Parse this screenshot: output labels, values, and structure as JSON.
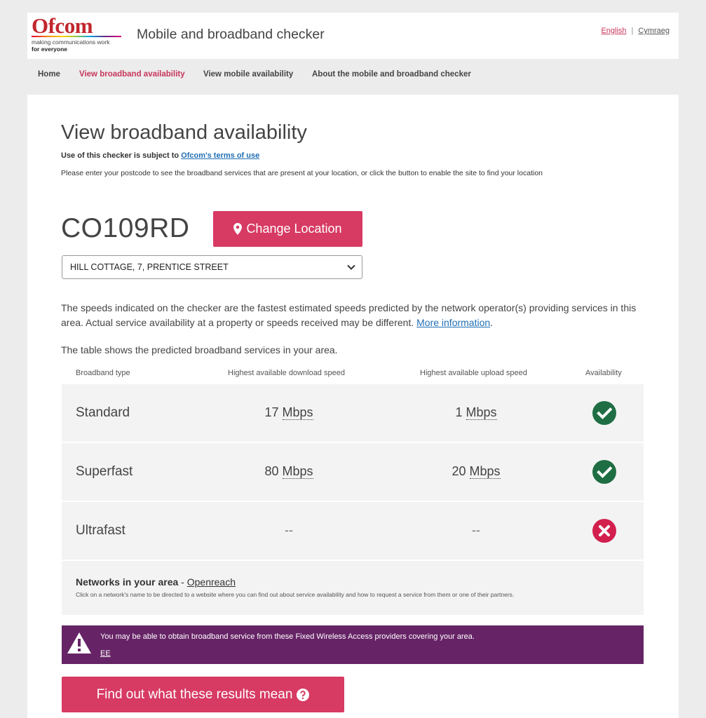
{
  "header": {
    "logo_text": "Ofcom",
    "logo_tagline": "making communications work",
    "logo_tagline2": "for everyone",
    "app_title": "Mobile and broadband checker",
    "lang_english": "English",
    "lang_separator": "|",
    "lang_welsh": "Cymraeg"
  },
  "nav": {
    "items": [
      {
        "label": "Home"
      },
      {
        "label": "View broadband availability"
      },
      {
        "label": "View mobile availability"
      },
      {
        "label": "About the mobile and broadband checker"
      }
    ],
    "active_index": 1
  },
  "main": {
    "title": "View broadband availability",
    "terms_prefix": "Use of this checker is subject to ",
    "terms_link": "Ofcom's terms of use",
    "intro": "Please enter your postcode to see the broadband services that are present at your location, or click the button to enable the site to find your location",
    "postcode": "CO109RD",
    "change_location_label": "Change Location",
    "address_selected": "HILL COTTAGE, 7, PRENTICE STREET",
    "speeds_note": "The speeds indicated on the checker are the fastest estimated speeds predicted by the network operator(s) providing services in this area. Actual service availability at a property or speeds received may be different.",
    "more_info_link": "More information",
    "speeds_note_end": ".",
    "table_note": "The table shows the predicted broadband services in your area."
  },
  "table": {
    "headers": {
      "type": "Broadband type",
      "download": "Highest available download speed",
      "upload": "Highest available upload speed",
      "availability": "Availability"
    },
    "rows": [
      {
        "type": "Standard",
        "download_value": "17",
        "download_unit": "Mbps",
        "upload_value": "1",
        "upload_unit": "Mbps",
        "available": true
      },
      {
        "type": "Superfast",
        "download_value": "80",
        "download_unit": "Mbps",
        "upload_value": "20",
        "upload_unit": "Mbps",
        "available": true
      },
      {
        "type": "Ultrafast",
        "download_value": "--",
        "download_unit": "",
        "upload_value": "--",
        "upload_unit": "",
        "available": false
      }
    ],
    "networks_label": "Networks in your area",
    "networks_sep": " - ",
    "networks_link": "Openreach",
    "networks_help": "Click on a network's name to be directed to a website where you can find out about service availability and how to request a service from them or one of their partners."
  },
  "fwa": {
    "message": "You may be able to obtain broadband service from these Fixed Wireless Access providers covering your area.",
    "provider": "EE"
  },
  "results_button": "Find out what these results mean",
  "colors": {
    "brand_pink": "#d73a63",
    "nav_active": "#c7365a",
    "available_green": "#1f6e43",
    "unavailable_red": "#d21f4e",
    "fwa_purple": "#662466",
    "link_blue": "#1f6eb3"
  },
  "icons": {
    "change_location": "map-marker-icon",
    "address_select": "chevron-down-icon",
    "available": "check-circle-icon",
    "unavailable": "x-circle-icon",
    "fwa": "warning-triangle-icon",
    "results": "question-circle-icon"
  }
}
